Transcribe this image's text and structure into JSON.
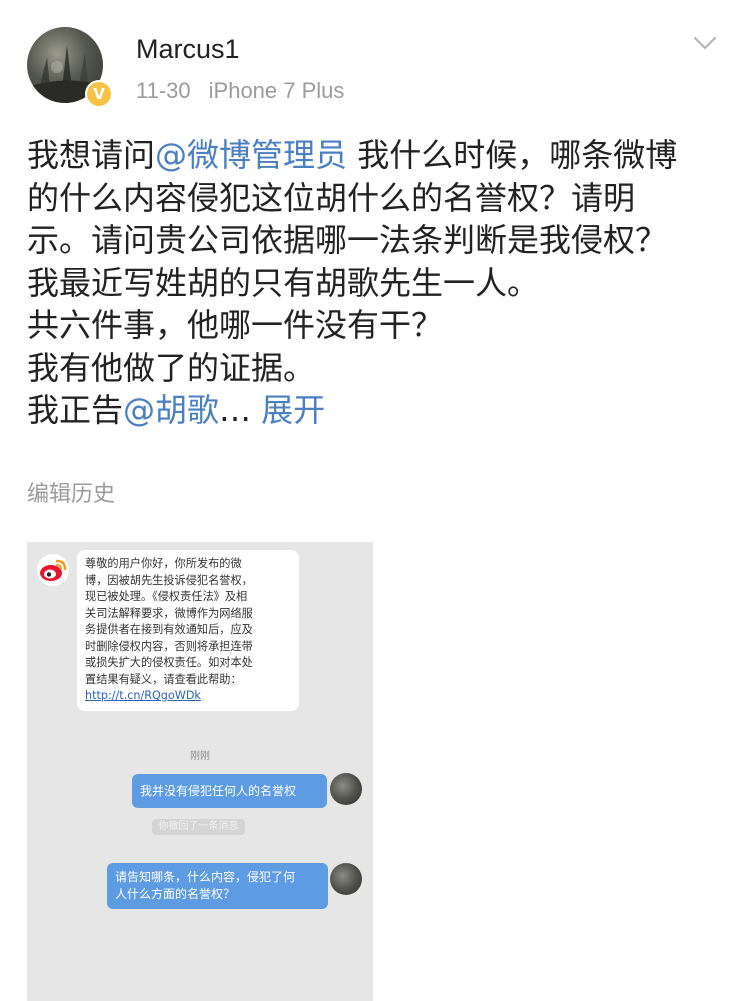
{
  "post": {
    "username": "Marcus1",
    "date": "11-30",
    "device": "iPhone 7 Plus",
    "verified_badge": "V",
    "text": {
      "l1_pre": "我想请问",
      "l1_mention": "@微博管理员",
      "l1_post": " 我什么时候，哪条微博",
      "l2": "的什么内容侵犯这位胡什么的名誉权？请明",
      "l3": "示。请问贵公司依据哪一法条判断是我侵权？",
      "l4": "我最近写姓胡的只有胡歌先生一人。",
      "l5": "共六件事，他哪一件没有干？",
      "l6": "我有他做了的证据。",
      "l7_pre": "我正告",
      "l7_mention": "@胡歌",
      "l7_ellipsis": "… ",
      "l7_expand": "展开"
    },
    "edit_history": "编辑历史",
    "link_color": "#4a7fc1"
  },
  "screenshot": {
    "notice_lines": [
      "尊敬的用户你好，你所发布的微",
      "博，因被胡先生投诉侵犯名誉权，",
      "现已被处理。《侵权责任法》及相",
      "关司法解释要求，微博作为网络服",
      "务提供者在接到有效通知后，应及",
      "时删除侵权内容，否则将承担连带",
      "或损失扩大的侵权责任。如对本处",
      "置结果有疑义，请查看此帮助："
    ],
    "notice_url": "http://t.cn/RQgoWDk",
    "time_label": "刚刚",
    "system_pill": "你撤回了一条消息",
    "bubble1": "我并没有侵犯任何人的名誉权",
    "bubble2_lines": [
      "请告知哪条，什么内容，侵犯了何",
      "人什么方面的名誉权？"
    ],
    "bubble_color": "#5d9be3"
  },
  "icons": {
    "chevron": "chevron-down-icon",
    "weibo": "weibo-logo-icon",
    "verified": "verified-badge-icon"
  }
}
